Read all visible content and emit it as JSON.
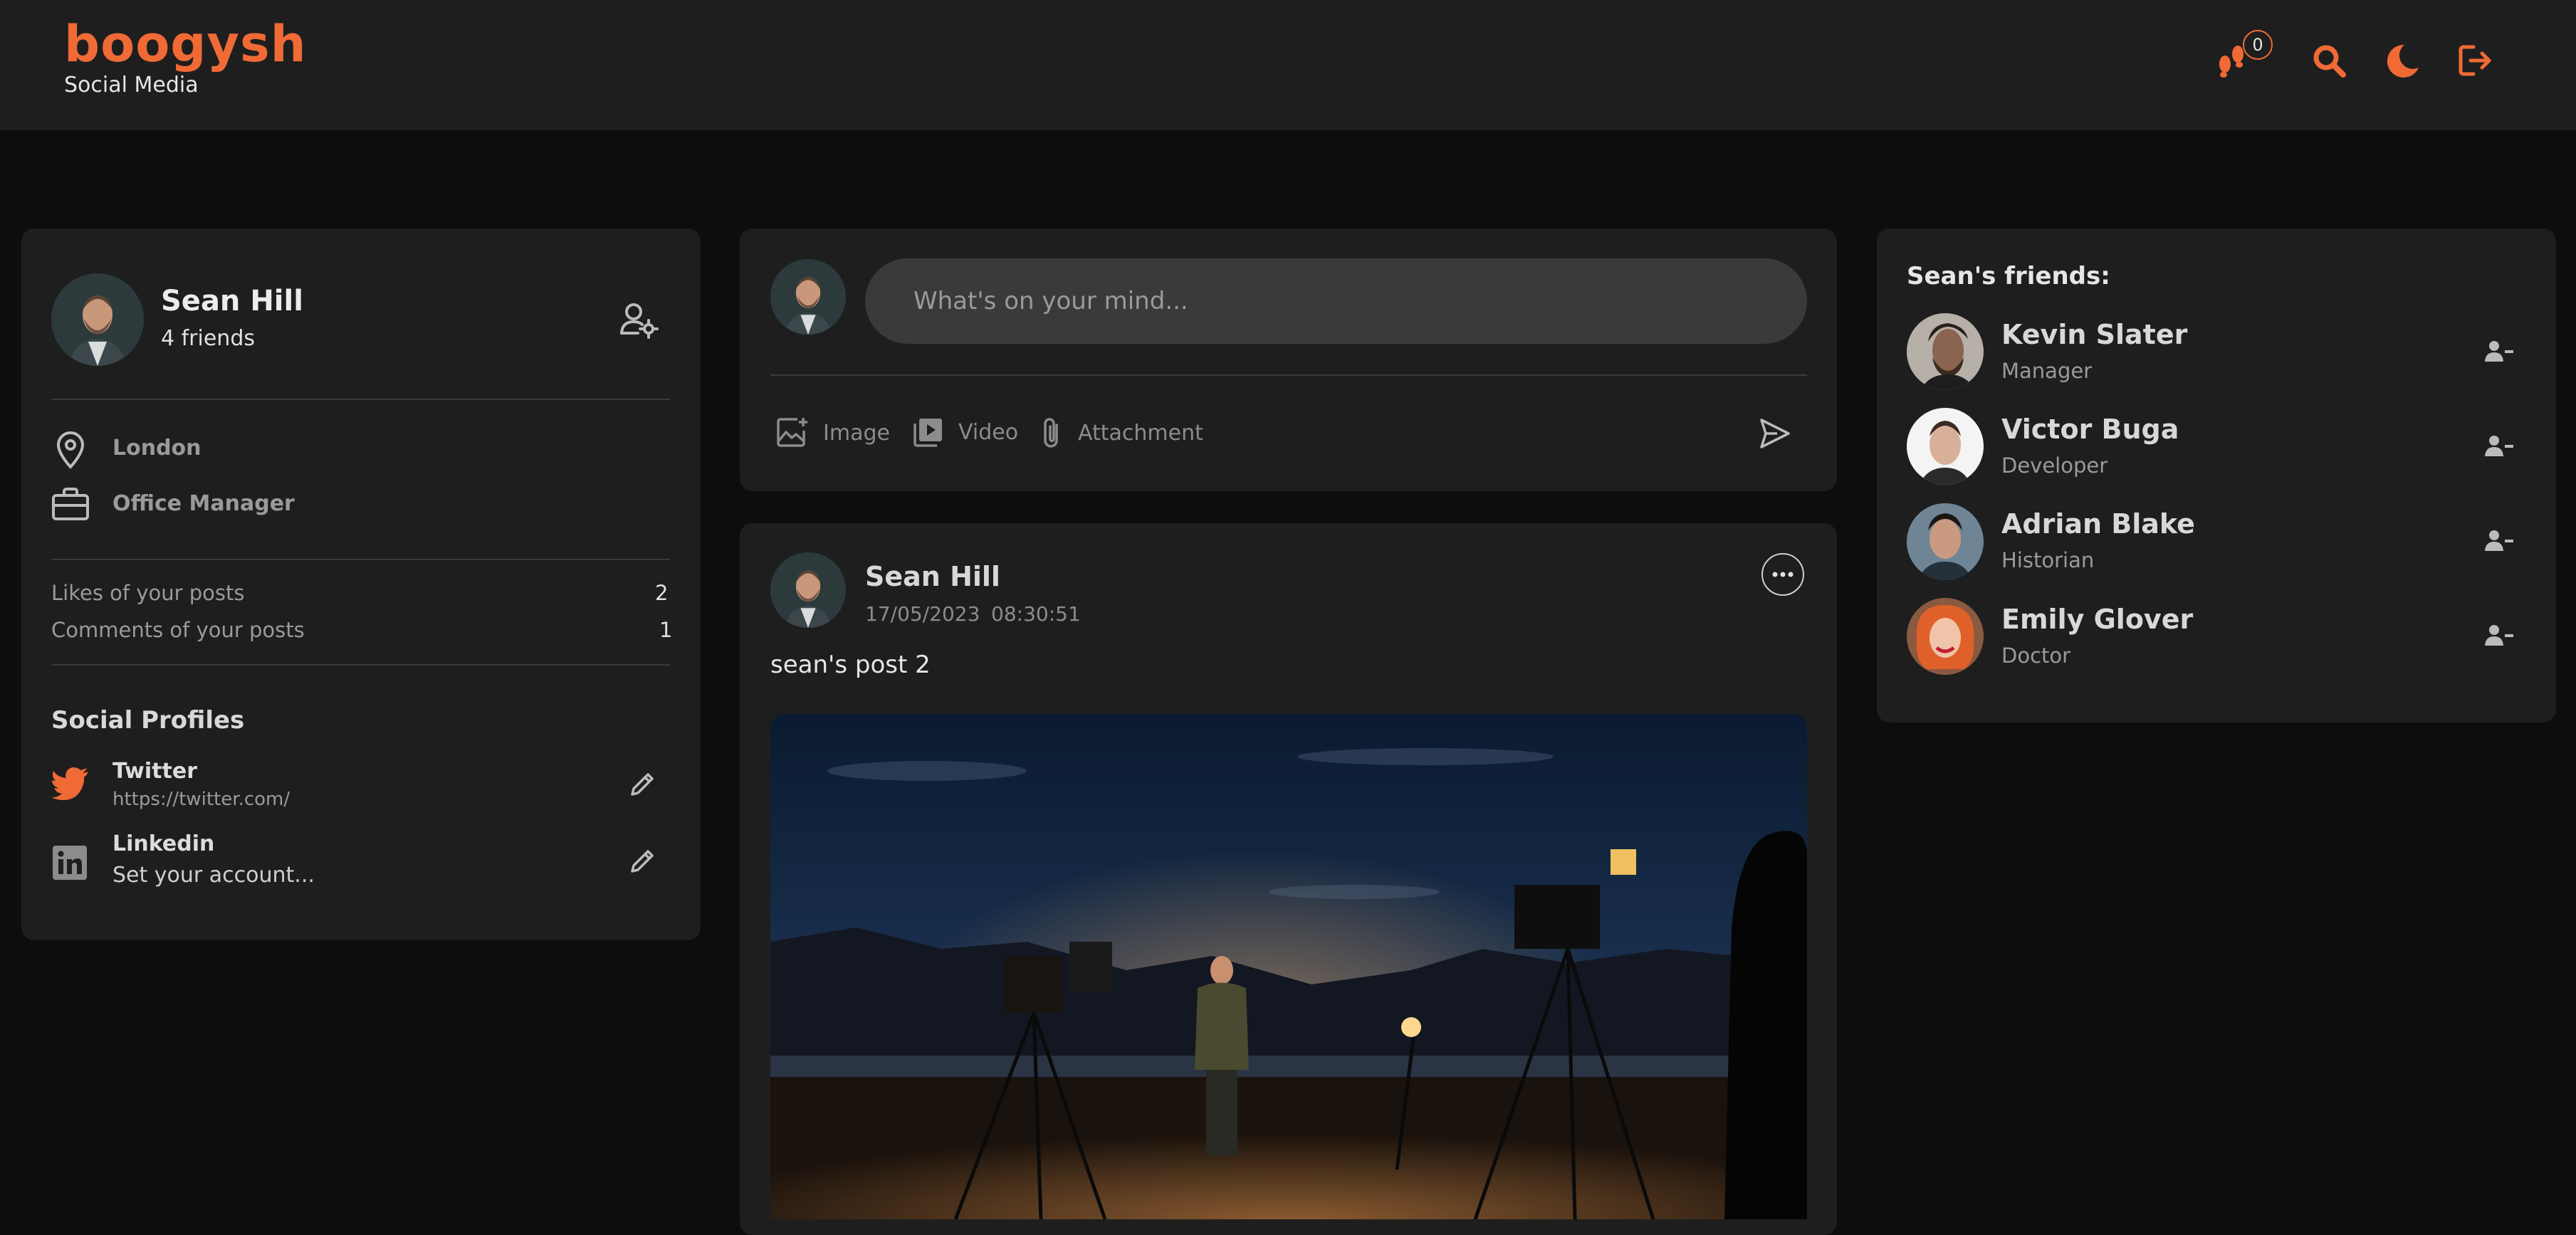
{
  "header": {
    "brand": "boogysh",
    "subtitle": "Social Media",
    "notification_count": "0",
    "accent": "#f06a35"
  },
  "profile": {
    "name": "Sean Hill",
    "friends_count": "4 friends",
    "location": "London",
    "occupation": "Office Manager",
    "stats": [
      {
        "label": "Likes of your posts",
        "value": "2"
      },
      {
        "label": "Comments of your posts",
        "value": "1"
      }
    ],
    "social_title": "Social Profiles",
    "socials": [
      {
        "name": "Twitter",
        "value": "https://twitter.com/"
      },
      {
        "name": "Linkedin",
        "value": "Set your account..."
      }
    ]
  },
  "composer": {
    "placeholder": "What's on your mind...",
    "actions": [
      "Image",
      "Video",
      "Attachment"
    ]
  },
  "post": {
    "author": "Sean Hill",
    "date": "17/05/2023",
    "time": "08:30:51",
    "text": "sean's post 2"
  },
  "friends": {
    "title": "Sean's friends:",
    "items": [
      {
        "name": "Kevin Slater",
        "role": "Manager"
      },
      {
        "name": "Victor Buga",
        "role": "Developer"
      },
      {
        "name": "Adrian Blake",
        "role": "Historian"
      },
      {
        "name": "Emily Glover",
        "role": "Doctor"
      }
    ]
  }
}
